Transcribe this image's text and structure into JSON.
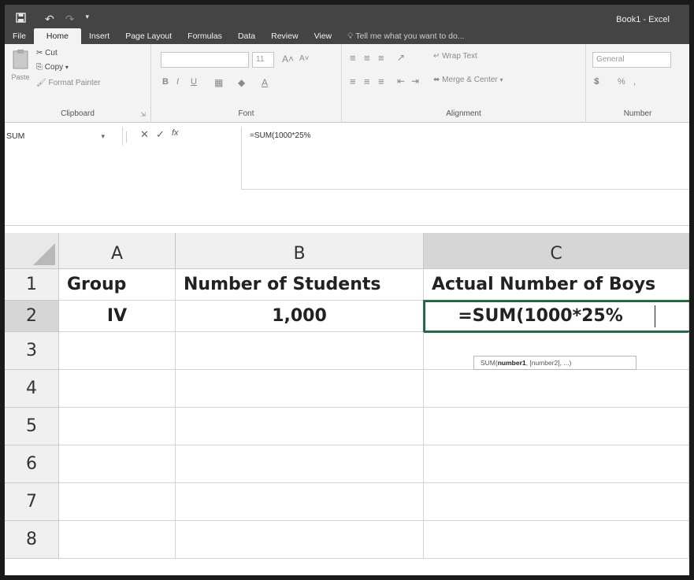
{
  "window": {
    "title": "Book1 - Excel"
  },
  "quick_access": {
    "save_icon": "save-icon",
    "undo_icon": "undo-icon",
    "redo_icon": "redo-icon",
    "customize_icon": "customize-icon"
  },
  "tabs": [
    {
      "label": "File"
    },
    {
      "label": "Home"
    },
    {
      "label": "Insert"
    },
    {
      "label": "Page Layout"
    },
    {
      "label": "Formulas"
    },
    {
      "label": "Data"
    },
    {
      "label": "Review"
    },
    {
      "label": "View"
    },
    {
      "label": "Tell me what you want to do..."
    }
  ],
  "ribbon": {
    "clipboard": {
      "paste": "Paste",
      "cut": "Cut",
      "copy": "Copy",
      "format_painter": "Format Painter",
      "label": "Clipboard"
    },
    "font": {
      "size": "11",
      "bold": "B",
      "italic": "I",
      "underline": "U",
      "label": "Font"
    },
    "alignment": {
      "wrap_text": "Wrap Text",
      "merge_center": "Merge & Center",
      "label": "Alignment"
    },
    "number": {
      "format": "General",
      "percent": "%",
      "label": "Number"
    }
  },
  "formula_bar": {
    "name_box": "SUM",
    "cancel": "✕",
    "enter": "✓",
    "fx": "fx",
    "formula": "=SUM(1000*25%"
  },
  "grid": {
    "columns": [
      "A",
      "B",
      "C"
    ],
    "rows": [
      "1",
      "2",
      "3",
      "4",
      "5",
      "6",
      "7",
      "8"
    ],
    "cells": {
      "A1": "Group",
      "B1": "Number of Students",
      "C1": "Actual Number of Boys",
      "A2": "IV",
      "B2": "1,000",
      "C2": "=SUM(1000*25%"
    },
    "tooltip": {
      "fn": "SUM(",
      "arg1": "number1",
      "rest": ", [number2], ...)"
    }
  },
  "colors": {
    "excel_green": "#217346",
    "titlebar": "#444444"
  }
}
